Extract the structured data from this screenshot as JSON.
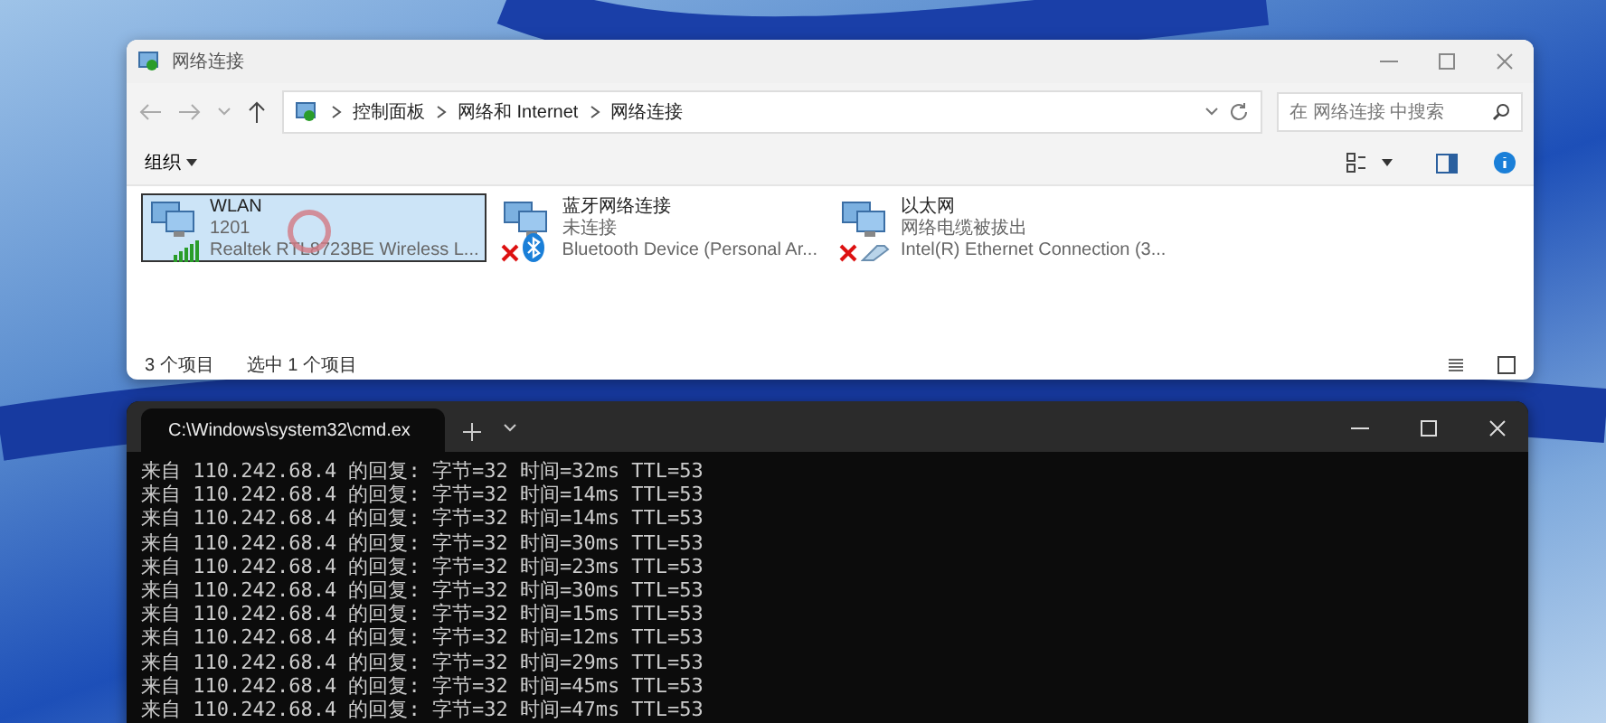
{
  "explorer": {
    "title": "网络连接",
    "breadcrumb": [
      "控制面板",
      "网络和 Internet",
      "网络连接"
    ],
    "search": {
      "placeholder": "在 网络连接 中搜索"
    },
    "organize": "组织",
    "items": [
      {
        "kind": "wifi",
        "name": "WLAN",
        "status": "1201",
        "device": "Realtek RTL8723BE Wireless L...",
        "selected": true
      },
      {
        "kind": "bluetooth",
        "name": "蓝牙网络连接",
        "status": "未连接",
        "device": "Bluetooth Device (Personal Ar...",
        "selected": false
      },
      {
        "kind": "ethernet",
        "name": "以太网",
        "status": "网络电缆被拔出",
        "device": "Intel(R) Ethernet Connection (3...",
        "selected": false
      }
    ],
    "status_bar": {
      "count": "3 个项目",
      "selection": "选中 1 个项目"
    }
  },
  "terminal": {
    "tab_title": "C:\\Windows\\system32\\cmd.ex",
    "lines": [
      "来自 110.242.68.4 的回复: 字节=32 时间=32ms TTL=53",
      "来自 110.242.68.4 的回复: 字节=32 时间=14ms TTL=53",
      "来自 110.242.68.4 的回复: 字节=32 时间=14ms TTL=53",
      "来自 110.242.68.4 的回复: 字节=32 时间=30ms TTL=53",
      "来自 110.242.68.4 的回复: 字节=32 时间=23ms TTL=53",
      "来自 110.242.68.4 的回复: 字节=32 时间=30ms TTL=53",
      "来自 110.242.68.4 的回复: 字节=32 时间=15ms TTL=53",
      "来自 110.242.68.4 的回复: 字节=32 时间=12ms TTL=53",
      "来自 110.242.68.4 的回复: 字节=32 时间=29ms TTL=53",
      "来自 110.242.68.4 的回复: 字节=32 时间=45ms TTL=53",
      "来自 110.242.68.4 的回复: 字节=32 时间=47ms TTL=53"
    ]
  }
}
